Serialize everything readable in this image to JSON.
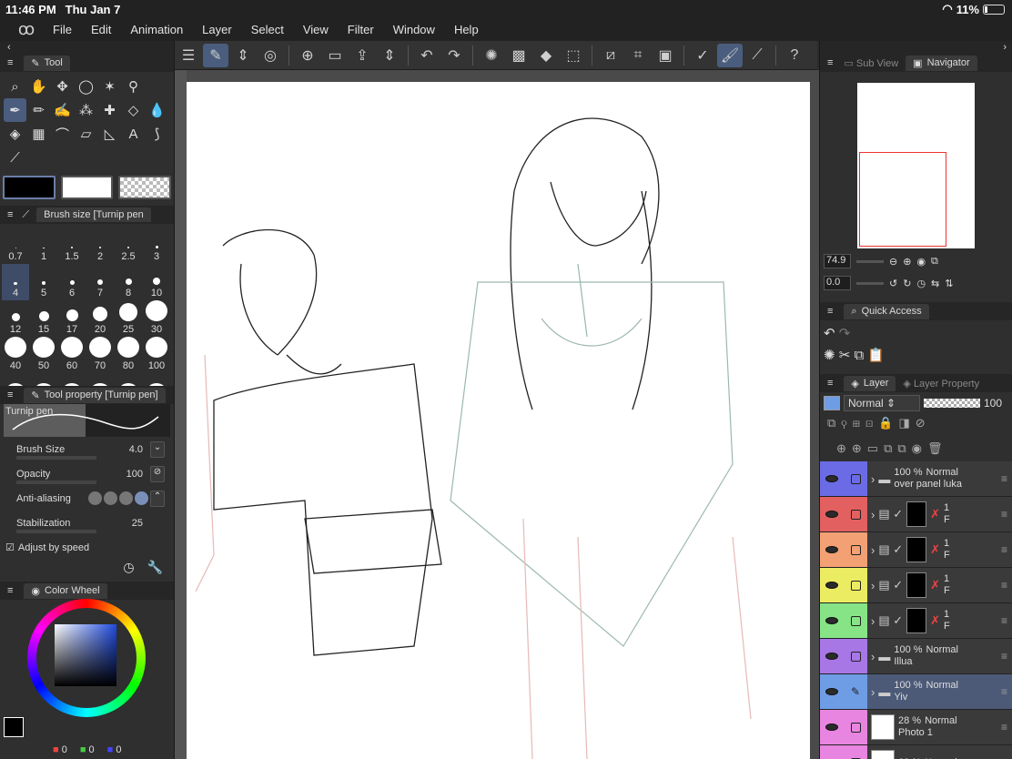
{
  "status": {
    "time": "11:46 PM",
    "date": "Thu Jan 7",
    "battery": "11%"
  },
  "menu": [
    "File",
    "Edit",
    "Animation",
    "Layer",
    "Select",
    "View",
    "Filter",
    "Window",
    "Help"
  ],
  "toolbar_icons": [
    "menu-icon",
    "pen-select-icon",
    "updown-icon",
    "lasso-icon",
    "new-page-icon",
    "open-icon",
    "export-icon",
    "updown-icon",
    "undo-icon",
    "redo-icon",
    "loading-icon",
    "fill-icon",
    "fill-clear-icon",
    "transform-icon",
    "deselect-icon",
    "crop-icon",
    "invert-icon",
    "draw-check-icon",
    "brush-icon",
    "ruler-icon",
    "help-icon"
  ],
  "left": {
    "tool_tab": "Tool",
    "brush_size_tab": "Brush size [Turnip pen",
    "sizes": [
      "0.7",
      "1",
      "1.5",
      "2",
      "2.5",
      "3",
      "4",
      "5",
      "6",
      "7",
      "8",
      "10",
      "12",
      "15",
      "17",
      "20",
      "25",
      "30",
      "40",
      "50",
      "60",
      "70",
      "80",
      "100",
      "",
      "",
      "",
      "",
      "",
      ""
    ],
    "selected_size": "4",
    "tool_property_tab": "Tool property [Turnip pen]",
    "pen_name": "Turnip pen",
    "props": [
      {
        "label": "Brush Size",
        "value": "4.0"
      },
      {
        "label": "Opacity",
        "value": "100"
      },
      {
        "label": "Anti-aliasing",
        "value": ""
      },
      {
        "label": "Stabilization",
        "value": "25"
      }
    ],
    "adjust_speed": "Adjust by speed",
    "color_wheel_tab": "Color Wheel",
    "rgb": {
      "r": "0",
      "g": "0",
      "b": "0"
    }
  },
  "right": {
    "subview_tab": "Sub View",
    "navigator_tab": "Navigator",
    "zoom": "74.9",
    "angle": "0.0",
    "quick_access_tab": "Quick Access",
    "layer_tab": "Layer",
    "layer_property_tab": "Layer Property",
    "blend_mode": "Normal",
    "opacity": "100",
    "layers": [
      {
        "color": "#6b6be6",
        "opacity": "100 %",
        "mode": "Normal",
        "name": "over panel luka",
        "type": "folder"
      },
      {
        "color": "#e36060",
        "opacity": "1",
        "mode": "",
        "name": "F",
        "type": "mask"
      },
      {
        "color": "#f2a074",
        "opacity": "1",
        "mode": "",
        "name": "F",
        "type": "mask"
      },
      {
        "color": "#ecec62",
        "opacity": "1",
        "mode": "",
        "name": "F",
        "type": "mask"
      },
      {
        "color": "#86e486",
        "opacity": "1",
        "mode": "",
        "name": "F",
        "type": "mask"
      },
      {
        "color": "#a877e6",
        "opacity": "100 %",
        "mode": "Normal",
        "name": "Illua",
        "type": "folder"
      },
      {
        "color": "#6e9de6",
        "opacity": "100 %",
        "mode": "Normal",
        "name": "Yiv",
        "type": "folder"
      },
      {
        "color": "#e885e0",
        "opacity": "28 %",
        "mode": "Normal",
        "name": "Photo 1",
        "type": "image"
      },
      {
        "color": "#e885e0",
        "opacity": "69 %",
        "mode": "Normal",
        "name": "",
        "type": "image"
      }
    ]
  },
  "colors": {
    "accent": "#4a5d7e",
    "panel": "#2f2f2f",
    "bar": "#222222"
  }
}
